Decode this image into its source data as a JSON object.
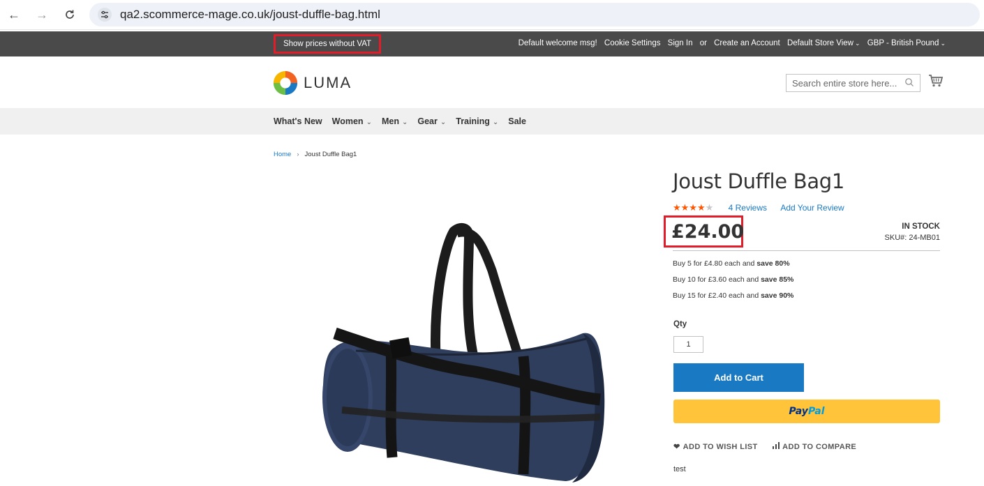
{
  "browser": {
    "back_icon": "←",
    "forward_icon": "→",
    "reload_icon": "C",
    "site_info_icon": "⚙",
    "url": "qa2.scommerce-mage.co.uk/joust-duffle-bag.html"
  },
  "top_panel": {
    "vat_toggle": "Show prices without VAT",
    "welcome": "Default welcome msg!",
    "cookie_settings": "Cookie Settings",
    "sign_in": "Sign In",
    "or": "or",
    "create_account": "Create an Account",
    "store_view": "Default Store View",
    "currency": "GBP - British Pound",
    "chevron": "⌄"
  },
  "header": {
    "logo_text": "LUMA",
    "search_placeholder": "Search entire store here..."
  },
  "nav": {
    "items": [
      {
        "label": "What's New",
        "dropdown": false
      },
      {
        "label": "Women",
        "dropdown": true
      },
      {
        "label": "Men",
        "dropdown": true
      },
      {
        "label": "Gear",
        "dropdown": true
      },
      {
        "label": "Training",
        "dropdown": true
      },
      {
        "label": "Sale",
        "dropdown": false
      }
    ],
    "chevron": "⌄"
  },
  "breadcrumb": {
    "home": "Home",
    "separator": "›",
    "current": "Joust Duffle Bag1"
  },
  "product": {
    "title": "Joust Duffle Bag1",
    "rating_stars_filled": 4,
    "rating_stars_total": 5,
    "stars_filled": "★★★★",
    "stars_empty": "★",
    "reviews": "4  Reviews",
    "add_review": "Add Your Review",
    "price": "£24.00",
    "stock": "IN STOCK",
    "sku": "SKU#:  24-MB01",
    "tiers": [
      {
        "text": "Buy 5 for £4.80 each and ",
        "save": "save 80%"
      },
      {
        "text": "Buy 10 for £3.60 each and ",
        "save": "save 85%"
      },
      {
        "text": "Buy 15 for £2.40 each and ",
        "save": "save 90%"
      }
    ],
    "qty_label": "Qty",
    "qty_value": "1",
    "add_to_cart": "Add to Cart",
    "paypal_1": "Pay",
    "paypal_2": "Pal",
    "wishlist": "ADD TO WISH LIST",
    "compare": "ADD TO COMPARE",
    "description": "test"
  },
  "colors": {
    "highlight": "#e11d2a",
    "link": "#1979c3",
    "star": "#ff5501",
    "paypal_yellow": "#ffc439",
    "top_panel": "#4a4a4a"
  }
}
